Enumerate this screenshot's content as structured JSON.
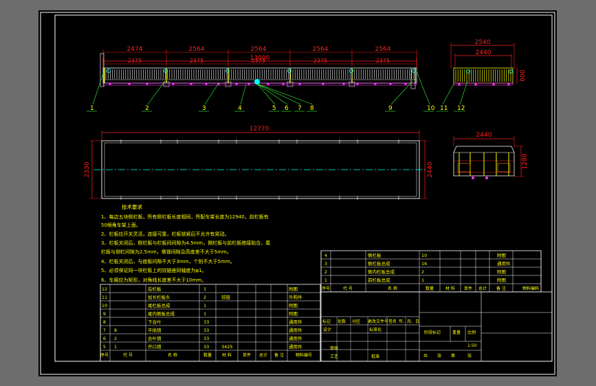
{
  "colors": {
    "app_background": "#6d6d6d",
    "sheet": "#000000",
    "frame": "#ffffff",
    "dimension": "#ff2020",
    "part": "#ffff00",
    "centerline": "#00ffff",
    "note_text": "#ffff00",
    "title_block": "#ffffff",
    "node": "#ff33ff",
    "leader": "#33ff33"
  },
  "side_view": {
    "overall_length": "13000",
    "segment_lengths": [
      "2474",
      "2564",
      "2564",
      "2564",
      "2564"
    ],
    "inner_lengths": [
      "2375",
      "2375",
      "2375",
      "2375",
      "2375"
    ],
    "balloons": [
      "1",
      "2",
      "3",
      "4",
      "5",
      "6",
      "7",
      "8",
      "9",
      "10"
    ]
  },
  "end_view": {
    "outer_width": "2540",
    "inner_width": "2440",
    "height": "600",
    "balloons": [
      "11",
      "12"
    ]
  },
  "plan_view": {
    "length": "12770",
    "width_left": "2330",
    "width_right": "2440"
  },
  "section_view": {
    "width": "2440",
    "height": "1280"
  },
  "technical_requirements": {
    "title": "技术要求",
    "lines": [
      "1、每边五块侧栏板，所有侧栏板长度相同，所配车架长度为12940，前栏板有",
      "50倾角车架上面。",
      "2、栏板应开关灵活，连接可靠，栏板锁紧后不允许有晃动。",
      "3、栏板关闭后，侧栏板与栏板间间隙为4.5mm，侧栏板与前栏板搭接贴合，尾",
      "栏板与侧栏间隙为2.5mm，需锁间隙及高度差不大于5mm。",
      "4、栏板关闭后，与底板间隙不大于3mm，个别不大于5mm。",
      "5、必须保证同一块栏板上的铰链座同轴度为φ1。",
      "6、车厢应为矩形，对角线长度差不大于10mm。"
    ]
  },
  "bom_lower": {
    "rows": [
      {
        "no": "12",
        "code": "",
        "name": "后栏板",
        "qty": "1",
        "mat": "",
        "note": "附图"
      },
      {
        "no": "11",
        "code": "",
        "name": "加长栏板头",
        "qty": "2",
        "mat": "铰链",
        "note": "外购件"
      },
      {
        "no": "10",
        "code": "",
        "name": "尾栏板总成",
        "qty": "1",
        "mat": "",
        "note": "附图"
      },
      {
        "no": "9",
        "code": "",
        "name": "尾内侧板总成",
        "qty": "1",
        "mat": "",
        "note": "附图"
      },
      {
        "no": "8",
        "code": "",
        "name": "下合叶",
        "qty": "33",
        "mat": "",
        "note": "通用件"
      },
      {
        "no": "7",
        "code": "8",
        "name": "平插销",
        "qty": "33",
        "mat": "",
        "note": "通用件"
      },
      {
        "no": "6",
        "code": "2",
        "name": "合叶销",
        "qty": "33",
        "mat": "",
        "note": "通用件"
      },
      {
        "no": "5",
        "code": "1",
        "name": "开口销",
        "qty": "33",
        "mat": "3425",
        "note": "通用件"
      }
    ],
    "header": {
      "no": "序号",
      "code": "代 号",
      "name": "名 称",
      "qty": "数量",
      "mat": "材 料",
      "unit_weight": "单件",
      "total_weight": "总计",
      "weight": "重量",
      "note": "备 注"
    },
    "footer_cells": [
      "物料编号",
      "工艺",
      "审核",
      "批准"
    ]
  },
  "bom_upper": {
    "rows": [
      {
        "no": "4",
        "name": "侧栏板",
        "qty": "10",
        "note": "附图"
      },
      {
        "no": "3",
        "name": "侧栏板总成",
        "qty": "16",
        "note": "通用件"
      },
      {
        "no": "2",
        "name": "侧内栏板总成",
        "qty": "2",
        "note": "附图"
      },
      {
        "no": "1",
        "name": "前栏板总成",
        "qty": "1",
        "note": "附图"
      }
    ],
    "header": {
      "no": "序号",
      "code": "代 号",
      "name": "名 称",
      "qty": "数量",
      "mat": "材 料",
      "unit_weight": "单件",
      "total_weight": "总计",
      "weight": "重量",
      "note": "备 注",
      "part_code": "物料编码"
    }
  },
  "title_block": {
    "change_row": [
      "标记",
      "处数",
      "分区",
      "更改文件号",
      "签名",
      "年、月、日"
    ],
    "design_row": [
      "设计",
      "",
      "标准化"
    ],
    "stage": "阶段标记",
    "weight": "重量",
    "scale_label": "比例",
    "scale": "1:50",
    "sheet_row": [
      "共",
      "张",
      "第",
      "张"
    ]
  }
}
